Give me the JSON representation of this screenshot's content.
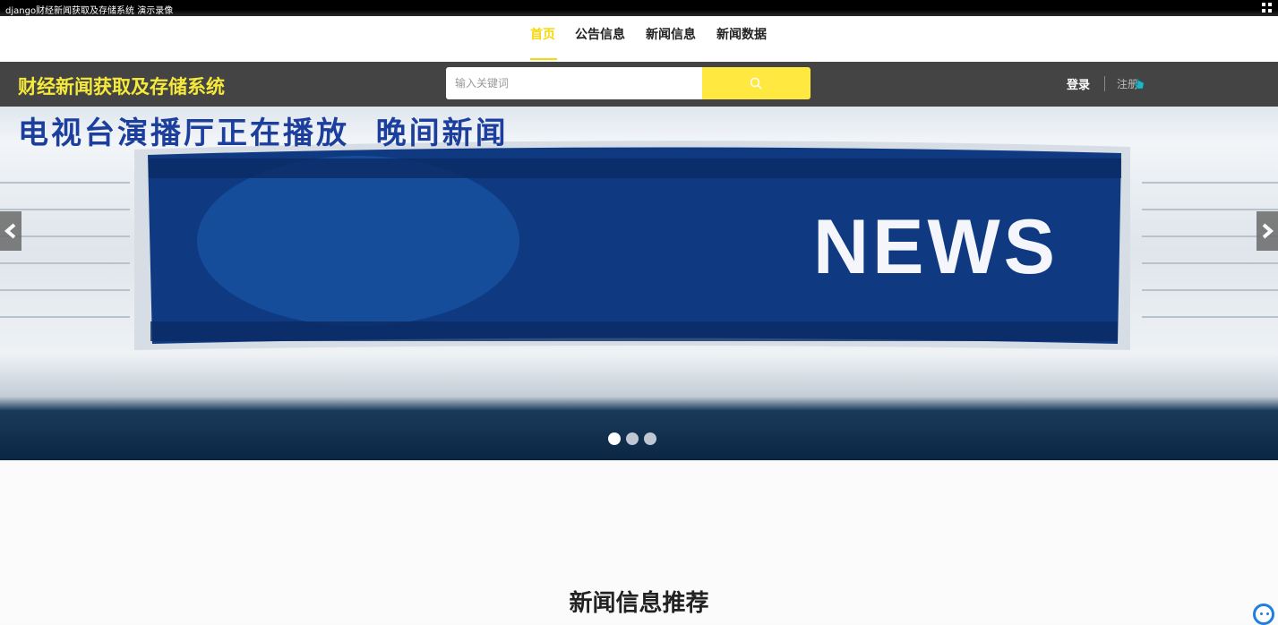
{
  "window": {
    "title": "django财经新闻获取及存储系统 演示录像"
  },
  "topnav": {
    "items": [
      {
        "label": "首页",
        "active": true
      },
      {
        "label": "公告信息",
        "active": false
      },
      {
        "label": "新闻信息",
        "active": false
      },
      {
        "label": "新闻数据",
        "active": false
      }
    ]
  },
  "header": {
    "brand": "财经新闻获取及存储系统",
    "search_placeholder": "输入关键词",
    "login_label": "登录",
    "register_label": "注册"
  },
  "banner": {
    "headline": "电视台演播厅正在播放  晚间新闻",
    "screen_text": "NEWS",
    "slide_count": 3,
    "active_slide": 1
  },
  "section": {
    "title": "新闻信息推荐"
  },
  "colors": {
    "accent": "#f5d90a",
    "header_bg": "#444444",
    "search_button": "#ffe941",
    "brand": "#f5e93b"
  },
  "icons": [
    "fullscreen-icon",
    "search-icon",
    "chevron-left-icon",
    "chevron-right-icon",
    "hand-cursor-icon",
    "chat-bot-icon"
  ]
}
